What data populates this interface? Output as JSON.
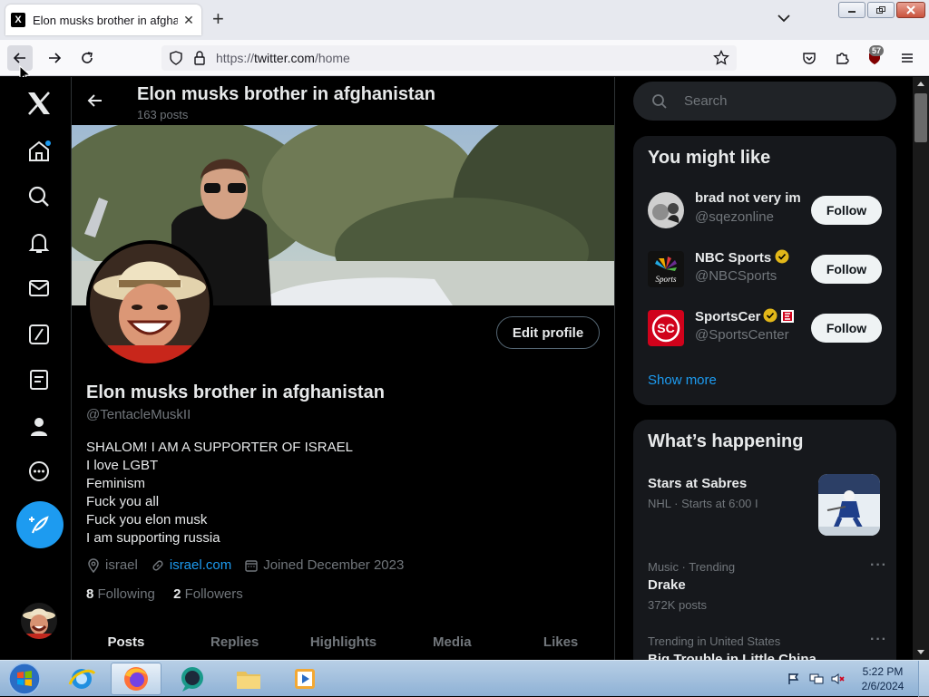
{
  "browser": {
    "tab_title": "Elon musks brother in afghanistan / X",
    "tab_favicon": "X",
    "url_scheme": "https://",
    "url_host": "twitter.com",
    "url_path": "/home",
    "extension_badge": "57"
  },
  "profile_header": {
    "name": "Elon musks brother in afghanistan",
    "post_count": "163 posts"
  },
  "profile": {
    "edit_button": "Edit profile",
    "name": "Elon musks brother in afghanistan",
    "handle": "@TentacleMuskII",
    "bio": [
      "SHALOM! I AM A SUPPORTER OF ISRAEL",
      "I love LGBT",
      "Feminism",
      "Fuck you all",
      "Fuck you elon musk",
      "I am supporting russia"
    ],
    "location": "israel",
    "link": "israel.com",
    "joined": "Joined December 2023",
    "following_count": "8",
    "following_label": "Following",
    "followers_count": "2",
    "followers_label": "Followers",
    "tabs": [
      "Posts",
      "Replies",
      "Highlights",
      "Media",
      "Likes"
    ]
  },
  "sidebar": {
    "search_placeholder": "Search",
    "might_like_title": "You might like",
    "suggestions": [
      {
        "name": "brad not very im",
        "handle": "@sqezonline",
        "follow": "Follow"
      },
      {
        "name": "NBC Sports",
        "handle": "@NBCSports",
        "follow": "Follow"
      },
      {
        "name": "SportsCer",
        "handle": "@SportsCenter",
        "follow": "Follow"
      }
    ],
    "show_more": "Show more",
    "happening_title": "What’s happening",
    "trends": [
      {
        "title": "Stars at Sabres",
        "category": "NHL · Starts at 6:00 I"
      },
      {
        "category": "Music · Trending",
        "title": "Drake",
        "count": "372K posts"
      },
      {
        "category": "Trending in United States",
        "title": "Big Trouble in Little China"
      }
    ]
  },
  "taskbar": {
    "time": "5:22 PM",
    "date": "2/6/2024"
  },
  "colors": {
    "accent": "#1d9bf0",
    "background": "#000000",
    "card": "#16181c",
    "text": "#e7e9ea",
    "muted": "#71767b",
    "verified": "#e2b719"
  }
}
